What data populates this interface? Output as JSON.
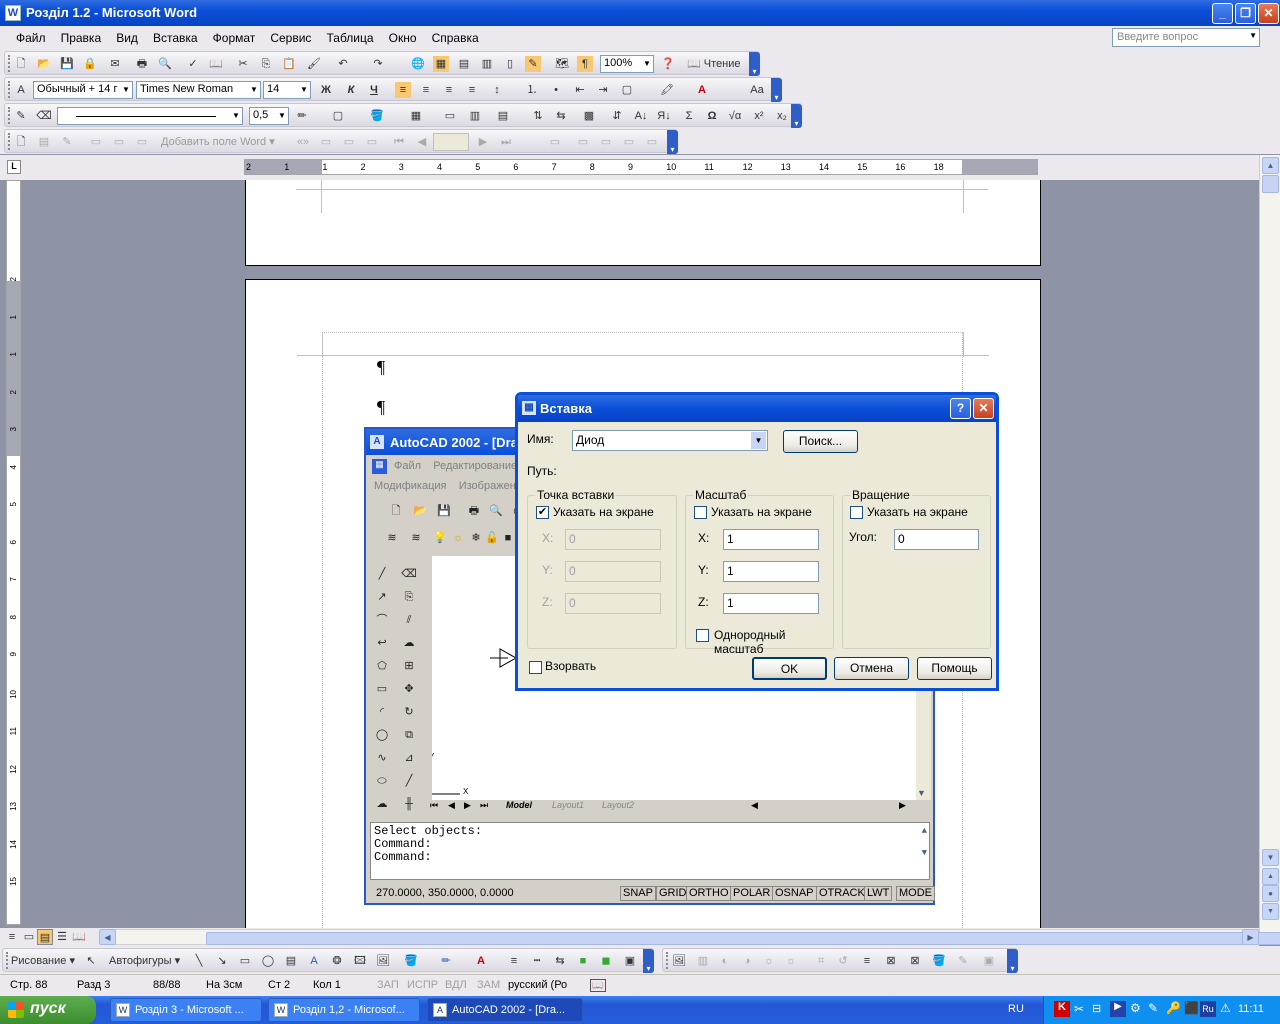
{
  "window": {
    "title": "Розділ 1.2 - Microsoft Word"
  },
  "menu": [
    "Файл",
    "Правка",
    "Вид",
    "Вставка",
    "Формат",
    "Сервис",
    "Таблица",
    "Окно",
    "Справка"
  ],
  "ask_placeholder": "Введите вопрос",
  "toolbar_std": {
    "zoom": "100%",
    "read_label": "Чтение"
  },
  "toolbar_fmt": {
    "style": "Обычный + 14 г",
    "font": "Times New Roman",
    "size": "14",
    "bold": "Ж",
    "italic": "К",
    "underline": "Ч"
  },
  "toolbar_tables": {
    "line_weight": "0,5"
  },
  "toolbar_forms": {
    "add_field": "Добавить поле Word"
  },
  "ruler": {
    "numbers": [
      "2",
      "1",
      "1",
      "2",
      "3",
      "4",
      "5",
      "6",
      "7",
      "8",
      "9",
      "10",
      "11",
      "12",
      "13",
      "14",
      "15",
      "16",
      "18"
    ]
  },
  "vruler": {
    "numbers": [
      "2",
      "1",
      "1",
      "2",
      "3",
      "4",
      "5",
      "6",
      "7",
      "8",
      "9",
      "10",
      "11",
      "12",
      "13",
      "14",
      "15"
    ]
  },
  "document": {
    "pilcrow1": "¶",
    "pilcrow2": "¶"
  },
  "autocad": {
    "title": "AutoCAD 2002 - [Dra",
    "menu1": [
      "Файл",
      "Редактирование"
    ],
    "menu2": [
      "Модификация",
      "Изображен"
    ],
    "tabs": [
      "Model",
      "Layout1",
      "Layout2"
    ],
    "command_lines": [
      "Select objects:",
      "Command:",
      "Command:"
    ],
    "coords": "270.0000, 350.0000, 0.0000",
    "status_buttons": [
      "SNAP",
      "GRID",
      "ORTHO",
      "POLAR",
      "OSNAP",
      "OTRACK",
      "LWT",
      "MODE"
    ],
    "axis_y": "Y",
    "axis_x": "X"
  },
  "dialog": {
    "title": "Вставка",
    "name_label": "Имя:",
    "name_value": "Диод",
    "browse": "Поиск...",
    "path_label": "Путь:",
    "insertion": {
      "title": "Точка вставки",
      "specify": "Указать на экране",
      "specify_checked": true,
      "x_label": "X:",
      "y_label": "Y:",
      "z_label": "Z:",
      "x": "0",
      "y": "0",
      "z": "0"
    },
    "scale": {
      "title": "Масштаб",
      "specify": "Указать на экране",
      "specify_checked": false,
      "x_label": "X:",
      "y_label": "Y:",
      "z_label": "Z:",
      "x": "1",
      "y": "1",
      "z": "1",
      "uniform": "Однородный масштаб",
      "uniform_checked": false
    },
    "rotation": {
      "title": "Вращение",
      "specify": "Указать на экране",
      "specify_checked": false,
      "angle_label": "Угол:",
      "angle": "0"
    },
    "explode": "Взорвать",
    "explode_checked": false,
    "ok": "OK",
    "cancel": "Отмена",
    "help": "Помощь"
  },
  "draw_toolbar": {
    "draw": "Рисование",
    "autoshapes": "Автофигуры"
  },
  "status": {
    "page": "Стр. 88",
    "section": "Разд 3",
    "pages": "88/88",
    "at": "На 3см",
    "line": "Ст 2",
    "col": "Кол 1",
    "rec": "ЗАП",
    "trk": "ИСПР",
    "ext": "ВДЛ",
    "ovr": "ЗАМ",
    "lang": "русский (Ро"
  },
  "taskbar": {
    "start": "пуск",
    "tasks": [
      "Розділ 3 - Microsoft ...",
      "Розділ 1,2 - Microsof...",
      "AutoCAD 2002 - [Dra..."
    ],
    "lang": "RU",
    "time": "11:11"
  },
  "colors": {
    "xp_blue": "#0a4fd8",
    "face": "#ece9d8",
    "start_green": "#3c8d2f"
  }
}
